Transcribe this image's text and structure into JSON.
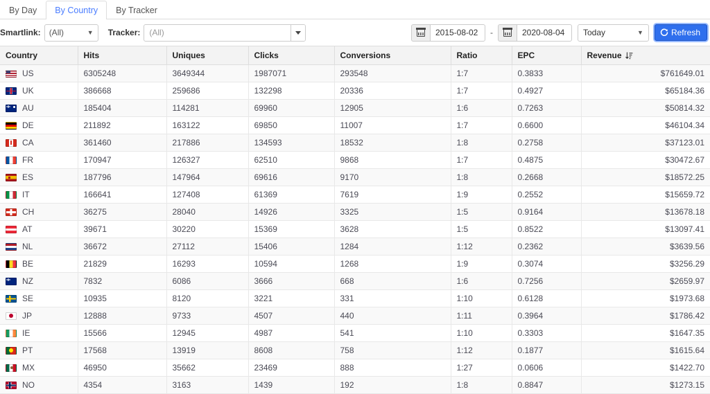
{
  "tabs": [
    {
      "label": "By Day",
      "active": false
    },
    {
      "label": "By Country",
      "active": true
    },
    {
      "label": "By Tracker",
      "active": false
    }
  ],
  "toolbar": {
    "smartlink_label": "Smartlink:",
    "smartlink_value": "(All)",
    "tracker_label": "Tracker:",
    "tracker_value": "(All)",
    "date_from": "2015-08-02",
    "date_separator": "-",
    "date_to": "2020-08-04",
    "range_preset": "Today",
    "refresh_label": "Refresh",
    "accent_color": "#2f6fed"
  },
  "table": {
    "columns": [
      {
        "key": "country",
        "label": "Country"
      },
      {
        "key": "hits",
        "label": "Hits"
      },
      {
        "key": "uniques",
        "label": "Uniques"
      },
      {
        "key": "clicks",
        "label": "Clicks"
      },
      {
        "key": "conversions",
        "label": "Conversions"
      },
      {
        "key": "ratio",
        "label": "Ratio"
      },
      {
        "key": "epc",
        "label": "EPC"
      },
      {
        "key": "revenue",
        "label": "Revenue"
      }
    ],
    "sorted_column": "Revenue",
    "sort_direction": "descending",
    "rows": [
      {
        "country": "US",
        "hits": "6305248",
        "uniques": "3649344",
        "clicks": "1987071",
        "conversions": "293548",
        "ratio": "1:7",
        "epc": "0.3833",
        "revenue": "$761649.01"
      },
      {
        "country": "UK",
        "hits": "386668",
        "uniques": "259686",
        "clicks": "132298",
        "conversions": "20336",
        "ratio": "1:7",
        "epc": "0.4927",
        "revenue": "$65184.36"
      },
      {
        "country": "AU",
        "hits": "185404",
        "uniques": "114281",
        "clicks": "69960",
        "conversions": "12905",
        "ratio": "1:6",
        "epc": "0.7263",
        "revenue": "$50814.32"
      },
      {
        "country": "DE",
        "hits": "211892",
        "uniques": "163122",
        "clicks": "69850",
        "conversions": "11007",
        "ratio": "1:7",
        "epc": "0.6600",
        "revenue": "$46104.34"
      },
      {
        "country": "CA",
        "hits": "361460",
        "uniques": "217886",
        "clicks": "134593",
        "conversions": "18532",
        "ratio": "1:8",
        "epc": "0.2758",
        "revenue": "$37123.01"
      },
      {
        "country": "FR",
        "hits": "170947",
        "uniques": "126327",
        "clicks": "62510",
        "conversions": "9868",
        "ratio": "1:7",
        "epc": "0.4875",
        "revenue": "$30472.67"
      },
      {
        "country": "ES",
        "hits": "187796",
        "uniques": "147964",
        "clicks": "69616",
        "conversions": "9170",
        "ratio": "1:8",
        "epc": "0.2668",
        "revenue": "$18572.25"
      },
      {
        "country": "IT",
        "hits": "166641",
        "uniques": "127408",
        "clicks": "61369",
        "conversions": "7619",
        "ratio": "1:9",
        "epc": "0.2552",
        "revenue": "$15659.72"
      },
      {
        "country": "CH",
        "hits": "36275",
        "uniques": "28040",
        "clicks": "14926",
        "conversions": "3325",
        "ratio": "1:5",
        "epc": "0.9164",
        "revenue": "$13678.18"
      },
      {
        "country": "AT",
        "hits": "39671",
        "uniques": "30220",
        "clicks": "15369",
        "conversions": "3628",
        "ratio": "1:5",
        "epc": "0.8522",
        "revenue": "$13097.41"
      },
      {
        "country": "NL",
        "hits": "36672",
        "uniques": "27112",
        "clicks": "15406",
        "conversions": "1284",
        "ratio": "1:12",
        "epc": "0.2362",
        "revenue": "$3639.56"
      },
      {
        "country": "BE",
        "hits": "21829",
        "uniques": "16293",
        "clicks": "10594",
        "conversions": "1268",
        "ratio": "1:9",
        "epc": "0.3074",
        "revenue": "$3256.29"
      },
      {
        "country": "NZ",
        "hits": "7832",
        "uniques": "6086",
        "clicks": "3666",
        "conversions": "668",
        "ratio": "1:6",
        "epc": "0.7256",
        "revenue": "$2659.97"
      },
      {
        "country": "SE",
        "hits": "10935",
        "uniques": "8120",
        "clicks": "3221",
        "conversions": "331",
        "ratio": "1:10",
        "epc": "0.6128",
        "revenue": "$1973.68"
      },
      {
        "country": "JP",
        "hits": "12888",
        "uniques": "9733",
        "clicks": "4507",
        "conversions": "440",
        "ratio": "1:11",
        "epc": "0.3964",
        "revenue": "$1786.42"
      },
      {
        "country": "IE",
        "hits": "15566",
        "uniques": "12945",
        "clicks": "4987",
        "conversions": "541",
        "ratio": "1:10",
        "epc": "0.3303",
        "revenue": "$1647.35"
      },
      {
        "country": "PT",
        "hits": "17568",
        "uniques": "13919",
        "clicks": "8608",
        "conversions": "758",
        "ratio": "1:12",
        "epc": "0.1877",
        "revenue": "$1615.64"
      },
      {
        "country": "MX",
        "hits": "46950",
        "uniques": "35662",
        "clicks": "23469",
        "conversions": "888",
        "ratio": "1:27",
        "epc": "0.0606",
        "revenue": "$1422.70"
      },
      {
        "country": "NO",
        "hits": "4354",
        "uniques": "3163",
        "clicks": "1439",
        "conversions": "192",
        "ratio": "1:8",
        "epc": "0.8847",
        "revenue": "$1273.15"
      }
    ]
  },
  "icons": {
    "calendar": "calendar-icon",
    "refresh": "refresh-icon",
    "sort_desc": "sort-descending-icon",
    "chevron_down": "chevron-down-icon"
  }
}
